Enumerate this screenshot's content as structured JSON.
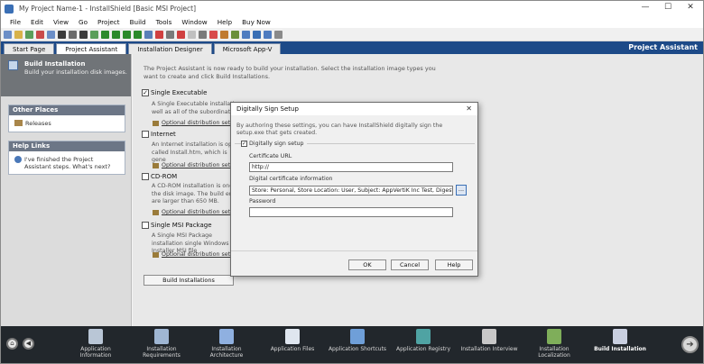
{
  "window": {
    "title": "My Project Name-1 - InstallShield [Basic MSI Project]",
    "minimize": "—",
    "maximize": "☐",
    "close": "✕"
  },
  "menu": [
    "File",
    "Edit",
    "View",
    "Go",
    "Project",
    "Build",
    "Tools",
    "Window",
    "Help",
    "Buy Now"
  ],
  "toolbar_colors": [
    "#6b8ec7",
    "#d8b24a",
    "#5a9e5a",
    "#c94b4b",
    "#6b8ec7",
    "#3a3a3a",
    "#6a6a6a",
    "#3a3a3a",
    "#5a9e5a",
    "#2b8a2b",
    "#2b8a2b",
    "#2b8a2b",
    "#2b8a2b",
    "#5a7fb8",
    "#d04040",
    "#7a7a7a",
    "#d04040",
    "#c0c0c0",
    "#7a7a7a",
    "#d84a4a",
    "#c07a30",
    "#6a8f3a",
    "#4f7cc0",
    "#3a6fb5",
    "#4f7cc0",
    "#8a8a8a"
  ],
  "tabs": [
    "Start Page",
    "Project Assistant",
    "Installation Designer",
    "Microsoft App-V"
  ],
  "active_tab": "Project Assistant",
  "header_title": "Project Assistant",
  "sidebar": {
    "title": "Build Installation",
    "subtitle": "Build your installation disk images.",
    "other_places": {
      "header": "Other Places",
      "item": "Releases"
    },
    "help_links": {
      "header": "Help Links",
      "item": "I've finished the Project Assistant steps. What's next?"
    }
  },
  "main": {
    "intro": "The Project Assistant is now ready to build your installation. Select the installation image types you want to create and click Build Installations.",
    "options": [
      {
        "label": "Single Executable",
        "checked": true,
        "desc": "A Single Executable installation well as all of the subordinate in",
        "link": "Optional distribution settin"
      },
      {
        "label": "Internet",
        "checked": false,
        "desc": "An Internet installation is optim called Install.htm, which is gene",
        "link": "Optional distribution settin"
      },
      {
        "label": "CD-ROM",
        "checked": false,
        "desc": "A CD-ROM installation is one in the disk image. The build engin are larger than 650 MB.",
        "link": "Optional distribution settin"
      },
      {
        "label": "Single MSI Package",
        "checked": false,
        "desc": "A Single MSI Package installation single Windows Installer MSI file",
        "link": "Optional distribution settin"
      }
    ],
    "build_button": "Build Installations"
  },
  "dialog": {
    "title": "Digitally Sign Setup",
    "close": "✕",
    "message": "By authoring these settings, you can have InstallShield digitally sign the setup.exe that gets created.",
    "sign_checkbox": "Digitally sign setup",
    "sign_checked": true,
    "cert_url_label": "Certificate URL",
    "cert_url_value": "http://",
    "cert_info_label": "Digital certificate information",
    "cert_info_value": "Store: Personal, Store Location: User, Subject: AppVertiK Inc Test, Digest Selectic",
    "browse_label": "...",
    "password_label": "Password",
    "password_value": "",
    "ok": "OK",
    "cancel": "Cancel",
    "help": "Help"
  },
  "dock": {
    "items": [
      {
        "label": "Application Information",
        "color": "#b9c6d6"
      },
      {
        "label": "Installation Requirements",
        "color": "#9fb6d3"
      },
      {
        "label": "Installation Architecture",
        "color": "#8fb0e0"
      },
      {
        "label": "Application Files",
        "color": "#dfe6ef"
      },
      {
        "label": "Application Shortcuts",
        "color": "#6f9fd8"
      },
      {
        "label": "Application Registry",
        "color": "#4fa3a3"
      },
      {
        "label": "Installation Interview",
        "color": "#c8c8c8"
      },
      {
        "label": "Installation Localization",
        "color": "#7fae5a"
      },
      {
        "label": "Build Installation",
        "color": "#c9cfe0"
      }
    ],
    "active": "Build Installation",
    "back": "◀",
    "home": "⌂",
    "next": "➔"
  }
}
